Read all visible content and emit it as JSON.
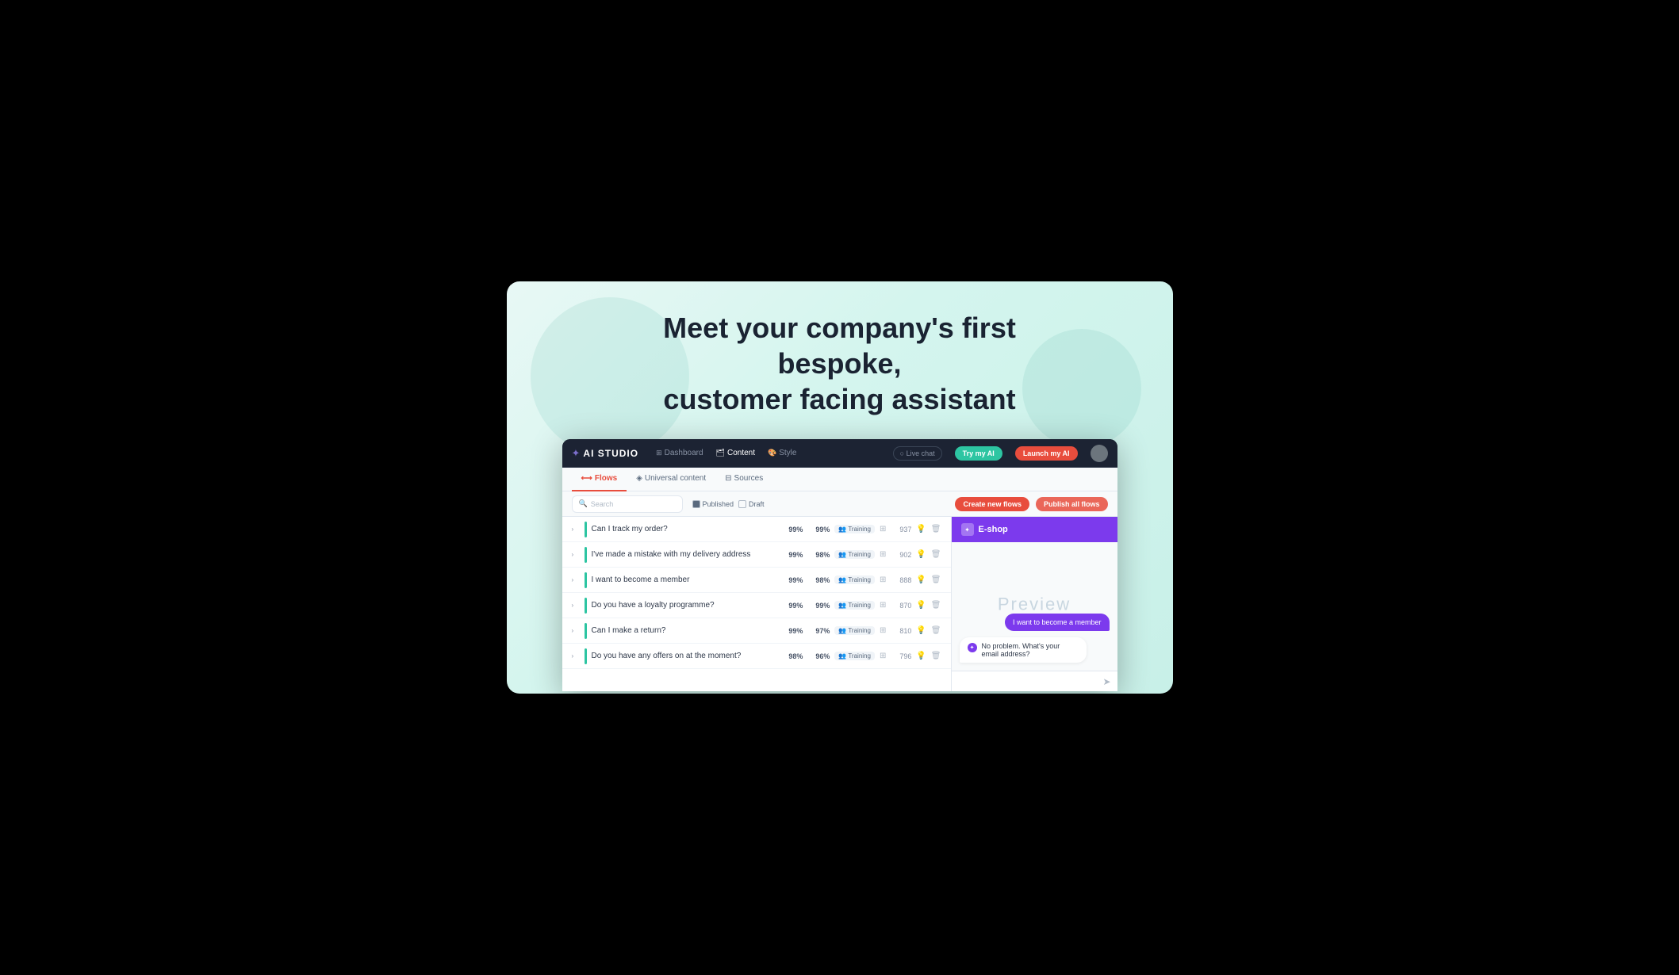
{
  "slide": {
    "title_line1": "Meet your company's first bespoke,",
    "title_line2": "customer facing assistant"
  },
  "app": {
    "logo": "AI STUDIO",
    "logo_icon": "✦",
    "nav": [
      {
        "label": "Dashboard",
        "icon": "⊞",
        "active": false
      },
      {
        "label": "Content",
        "icon": "🗂",
        "active": true
      },
      {
        "label": "Style",
        "icon": "🎨",
        "active": false
      }
    ],
    "header_buttons": {
      "live_chat": "○ Live chat",
      "try_my_ai": "Try my AI",
      "launch_my_ai": "Launch my AI"
    },
    "sub_tabs": [
      {
        "label": "Flows",
        "icon": "⟷",
        "active": true
      },
      {
        "label": "Universal content",
        "icon": "◈",
        "active": false
      },
      {
        "label": "Sources",
        "icon": "⊟",
        "active": false
      }
    ],
    "toolbar": {
      "search_placeholder": "Search",
      "filter_published": "Published",
      "filter_draft": "Draft",
      "create_btn": "Create new flows",
      "publish_btn": "Publish all flows"
    },
    "flows": [
      {
        "name": "Can I track my order?",
        "pct1": "99%",
        "pct2": "99%",
        "badge": "Training",
        "count": "937"
      },
      {
        "name": "I've made a mistake with my delivery address",
        "pct1": "99%",
        "pct2": "98%",
        "badge": "Training",
        "count": "902"
      },
      {
        "name": "I want to become a member",
        "pct1": "99%",
        "pct2": "98%",
        "badge": "Training",
        "count": "888"
      },
      {
        "name": "Do you have a loyalty programme?",
        "pct1": "99%",
        "pct2": "99%",
        "badge": "Training",
        "count": "870"
      },
      {
        "name": "Can I make a return?",
        "pct1": "99%",
        "pct2": "97%",
        "badge": "Training",
        "count": "810"
      },
      {
        "name": "Do you have any offers on at the moment?",
        "pct1": "98%",
        "pct2": "96%",
        "badge": "Training",
        "count": "796"
      }
    ],
    "preview": {
      "title": "E-shop",
      "watermark": "Preview",
      "chat_user": "I want to become a member",
      "chat_bot": "No problem. What's your email address?"
    }
  }
}
